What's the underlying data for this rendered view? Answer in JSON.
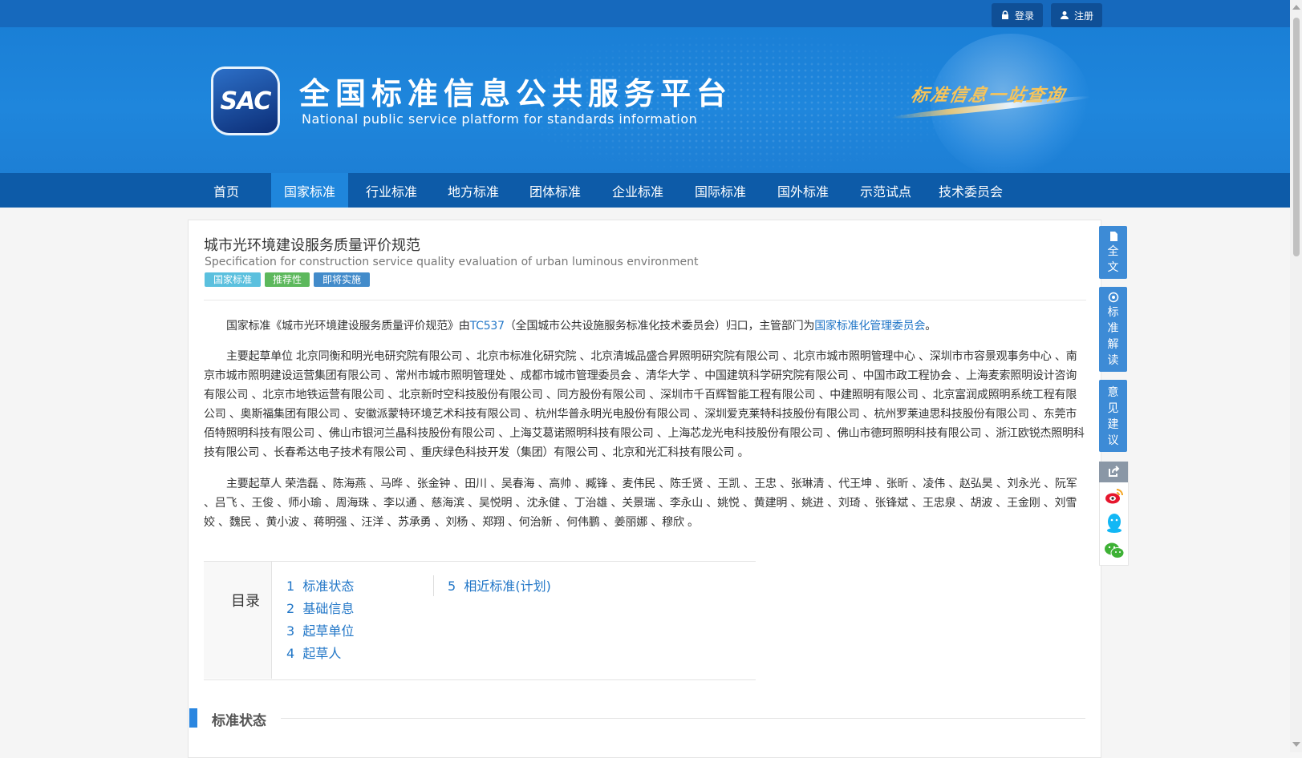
{
  "auth": {
    "login_label": "登录",
    "register_label": "注册"
  },
  "header": {
    "logo_text": "SAC",
    "site_title": "全国标准信息公共服务平台",
    "site_subtitle": "National public service platform  for standards information",
    "slogan": "标准信息一站查询"
  },
  "nav": {
    "items": [
      {
        "label": "首页"
      },
      {
        "label": "国家标准"
      },
      {
        "label": "行业标准"
      },
      {
        "label": "地方标准"
      },
      {
        "label": "团体标准"
      },
      {
        "label": "企业标准"
      },
      {
        "label": "国际标准"
      },
      {
        "label": "国外标准"
      },
      {
        "label": "示范试点"
      },
      {
        "label": "技术委员会"
      }
    ],
    "active_index": 1
  },
  "standard": {
    "title": "城市光环境建设服务质量评价规范",
    "title_en": "Specification for construction service quality evaluation of urban luminous environment",
    "tags": [
      "国家标准",
      "推荐性",
      "即将实施"
    ],
    "intro": {
      "prefix": "国家标准《城市光环境建设服务质量评价规范》由",
      "tc_link": "TC537",
      "middle": "（全国城市公共设施服务标准化技术委员会）归口，主管部门为",
      "dept_link": "国家标准化管理委员会",
      "suffix": "。"
    },
    "drafting_units": "主要起草单位 北京同衡和明光电研究院有限公司 、北京市标准化研究院 、北京清城品盛合昇照明研究院有限公司 、北京市城市照明管理中心 、深圳市市容景观事务中心 、南京市城市照明建设运营集团有限公司 、常州市城市照明管理处 、成都市城市管理委员会 、清华大学 、中国建筑科学研究院有限公司 、中国市政工程协会 、上海麦索照明设计咨询有限公司 、北京市地铁运营有限公司 、北京新时空科技股份有限公司 、同方股份有限公司 、深圳市千百辉智能工程有限公司 、中建照明有限公司 、北京富润成照明系统工程有限公司 、奥斯福集团有限公司 、安徽派蒙特环境艺术科技有限公司 、杭州华普永明光电股份有限公司 、深圳爱克莱特科技股份有限公司 、杭州罗莱迪思科技股份有限公司 、东莞市佰特照明科技有限公司 、佛山市银河兰晶科技股份有限公司 、上海艾葛诺照明科技有限公司 、上海芯龙光电科技股份有限公司 、佛山市德珂照明科技有限公司 、浙江欧锐杰照明科技有限公司 、长春希达电子技术有限公司 、重庆绿色科技开发（集团）有限公司 、北京和光汇科技有限公司 。",
    "drafters": "主要起草人 荣浩磊 、陈海燕 、马晔 、张金钟 、田川 、吴春海 、高帅 、臧锋 、麦伟民 、陈壬贤 、王凯 、王忠 、张琳清 、代王坤 、张昕 、凌伟 、赵弘昊 、刘永光 、阮军 、吕飞 、王俊 、师小瑜 、周海珠 、李以通 、慈海滨 、吴悦明 、沈永健 、丁治雄 、关景瑞 、李永山 、姚悦 、黄建明 、姚进 、刘琦 、张锋斌 、王忠泉 、胡波 、王金刚 、刘雪姣 、魏民 、黄小波 、蒋明强 、汪洋 、苏承勇 、刘杨 、郑翔 、何治新 、何伟鹏 、姜丽娜 、穆欣 。"
  },
  "toc": {
    "label": "目录",
    "items": [
      {
        "num": "1",
        "label": "标准状态"
      },
      {
        "num": "2",
        "label": "基础信息"
      },
      {
        "num": "3",
        "label": "起草单位"
      },
      {
        "num": "4",
        "label": "起草人"
      },
      {
        "num": "5",
        "label": "相近标准(计划)"
      }
    ]
  },
  "section": {
    "title": "标准状态"
  },
  "sidebar": {
    "fulltext": "全文",
    "interpretation": "标准解读",
    "feedback": "意见建议"
  },
  "colors": {
    "nav_bg": "#0d5ba8",
    "nav_active": "#1f86dc",
    "link": "#2176c7",
    "tag_national": "#5bc0de",
    "tag_recommend": "#5cb85c",
    "tag_upcoming": "#428bca"
  }
}
